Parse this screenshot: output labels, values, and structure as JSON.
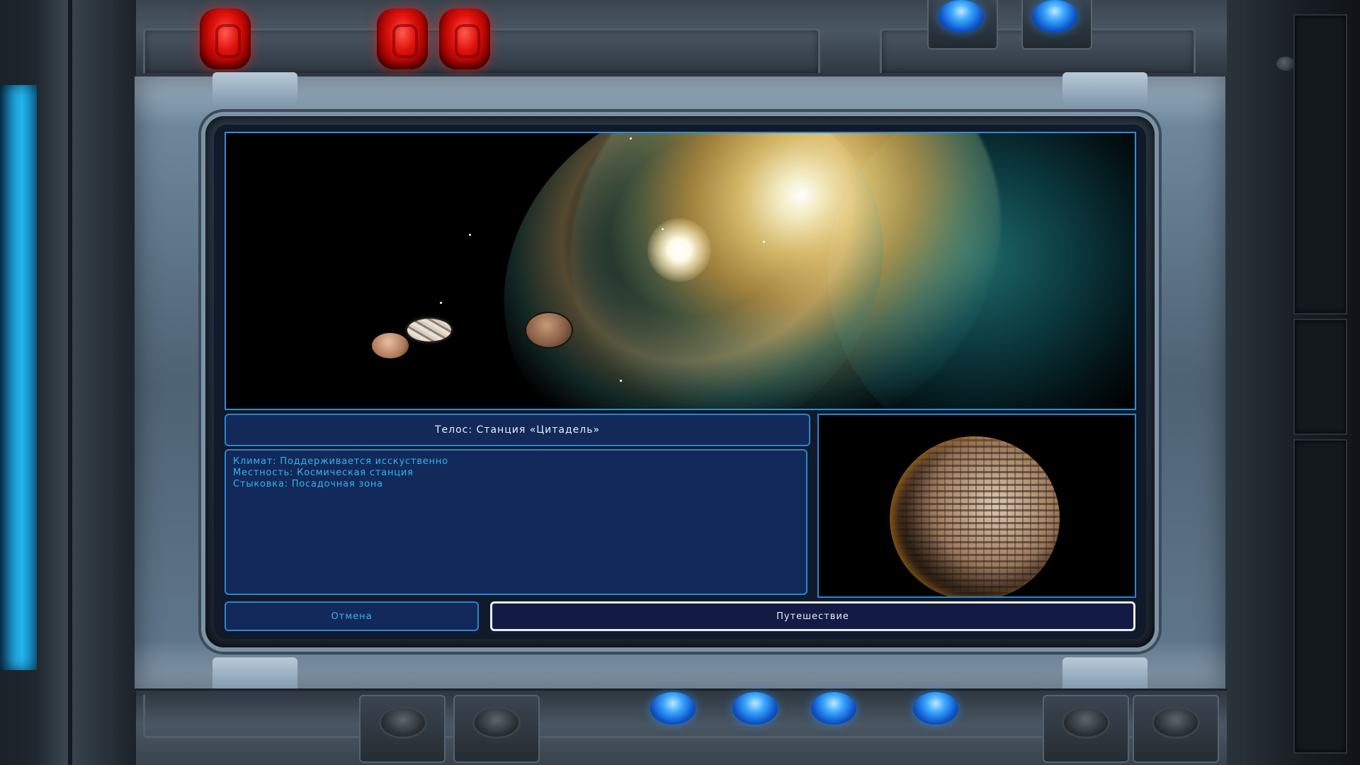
{
  "destination": {
    "title": "Телос: Станция «Цитадель»"
  },
  "details": [
    "Климат: Поддерживается исскуственно",
    "Местность: Космическая станция",
    "Стыковка: Посадочная зона"
  ],
  "buttons": {
    "cancel": "Отмена",
    "travel": "Путешествие"
  },
  "colors": {
    "panel_bg": "#13295a",
    "panel_border": "#2a86cf",
    "accent_text": "#2fb6f0",
    "primary_button_border": "#e8ecf0"
  },
  "icons": {
    "top_left_lights": [
      "red-light",
      "red-light",
      "red-light"
    ],
    "top_right_lights": [
      "blue-light",
      "blue-light"
    ],
    "bottom_lights": [
      "gray-light",
      "gray-light",
      "blue-light",
      "blue-light",
      "blue-light",
      "blue-light",
      "gray-light",
      "gray-light"
    ]
  }
}
